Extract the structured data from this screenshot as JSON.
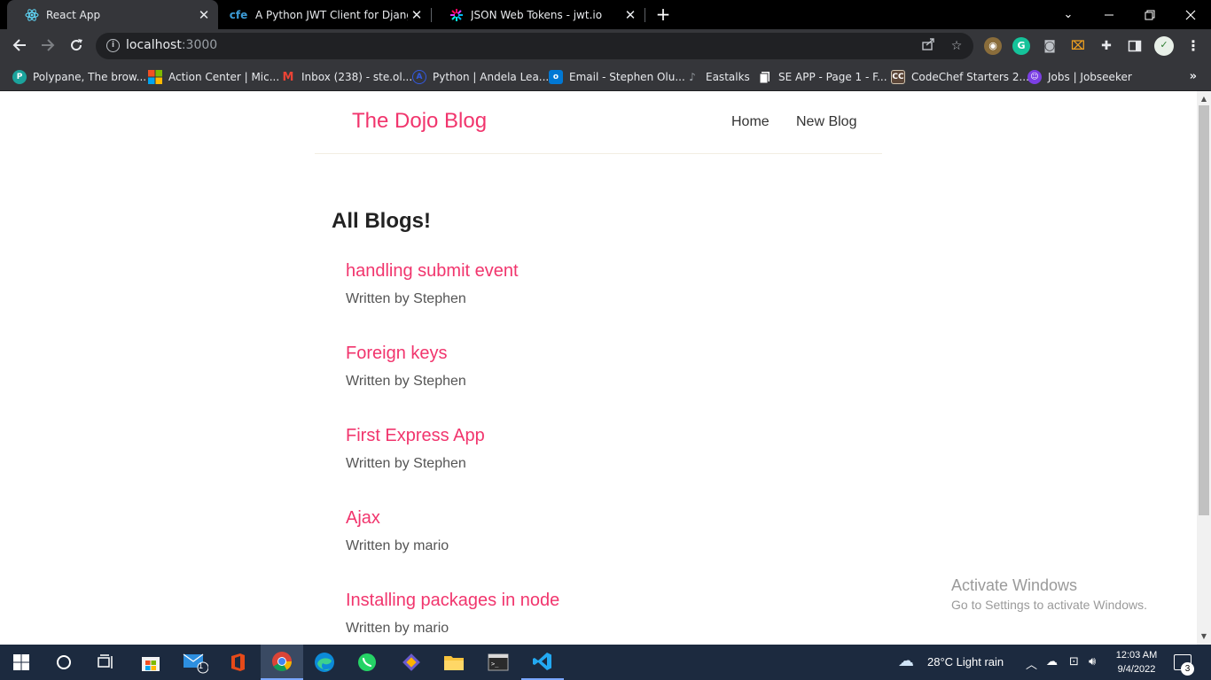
{
  "browser": {
    "tabs": [
      {
        "title": "React App",
        "active": true,
        "favicon": "react-icon"
      },
      {
        "title": "A Python JWT Client for Django R",
        "active": false,
        "favicon": "cfe-icon",
        "favicon_text": "cfe"
      },
      {
        "title": "JSON Web Tokens - jwt.io",
        "active": false,
        "favicon": "jwt-icon"
      }
    ],
    "address": {
      "host": "localhost",
      "port": ":3000"
    },
    "bookmarks": [
      {
        "label": "Polypane, The brow...",
        "icon": "polypane-icon",
        "color": "#1ba39c"
      },
      {
        "label": "Action Center | Mic...",
        "icon": "microsoft-icon",
        "color": "#f25022"
      },
      {
        "label": "Inbox (238) - ste.ol...",
        "icon": "gmail-icon",
        "color": "#ea4335"
      },
      {
        "label": "Python | Andela Lea...",
        "icon": "andela-icon",
        "color": "#3359df"
      },
      {
        "label": "Email - Stephen Olu...",
        "icon": "outlook-icon",
        "color": "#0078d4"
      },
      {
        "label": "Eastalks",
        "icon": "microphone-icon",
        "color": "#5f6368"
      },
      {
        "label": "SE APP - Page 1 - F...",
        "icon": "page-icon",
        "color": "#ffffff"
      },
      {
        "label": "CodeChef Starters 2...",
        "icon": "codechef-icon",
        "color": "#5b4638",
        "icon_text": "CC"
      },
      {
        "label": "Jobs | Jobseeker",
        "icon": "jobseeker-icon",
        "color": "#7b3fe4"
      }
    ]
  },
  "site": {
    "brand": "The Dojo Blog",
    "nav": [
      {
        "label": "Home"
      },
      {
        "label": "New Blog"
      }
    ],
    "heading": "All Blogs!",
    "blogs": [
      {
        "title": "handling submit event",
        "author": "Written by Stephen"
      },
      {
        "title": "Foreign keys",
        "author": "Written by Stephen"
      },
      {
        "title": "First Express App",
        "author": "Written by Stephen"
      },
      {
        "title": "Ajax",
        "author": "Written by mario"
      },
      {
        "title": "Installing packages in node",
        "author": "Written by mario"
      }
    ]
  },
  "watermark": {
    "title": "Activate Windows",
    "subtitle": "Go to Settings to activate Windows."
  },
  "taskbar": {
    "weather": "28°C  Light rain",
    "time": "12:03 AM",
    "date": "9/4/2022",
    "mail_badge": "1",
    "notification_count": "3"
  },
  "colors": {
    "brand_pink": "#f1356d",
    "chrome_dark": "#35363a",
    "taskbar": "#1c2a3f"
  }
}
